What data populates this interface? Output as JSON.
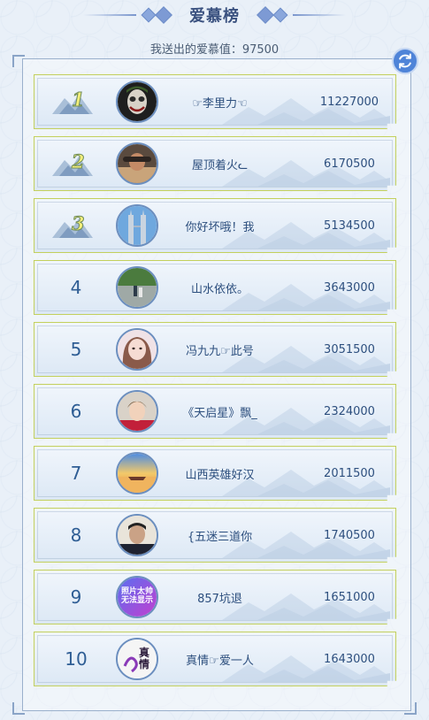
{
  "header": {
    "title": "爱慕榜"
  },
  "sent": {
    "label": "我送出的爱慕值：97500"
  },
  "colors": {
    "accent": "#4f84d8",
    "row_border": "#c3d05c",
    "text": "#2d4f7e"
  },
  "rows": [
    {
      "rank": "1",
      "name": "☞李里力☜",
      "score": "11227000",
      "avatar": "dark-portrait"
    },
    {
      "rank": "2",
      "name": "屋顶着火ᓚ",
      "score": "6170500",
      "avatar": "sunset-portrait"
    },
    {
      "rank": "3",
      "name": "你好坏哦！我",
      "score": "5134500",
      "avatar": "towers"
    },
    {
      "rank": "4",
      "name": "山水依依。",
      "score": "3643000",
      "avatar": "landscape"
    },
    {
      "rank": "5",
      "name": "冯九九☞此号",
      "score": "3051500",
      "avatar": "girl-portrait"
    },
    {
      "rank": "6",
      "name": "《天启星》飘_",
      "score": "2324000",
      "avatar": "boy-portrait"
    },
    {
      "rank": "7",
      "name": "山西英雄好汉",
      "score": "2011500",
      "avatar": "sunset-boat"
    },
    {
      "rank": "8",
      "name": "{五迷三道你",
      "score": "1740500",
      "avatar": "man-portrait"
    },
    {
      "rank": "9",
      "name": "857坑退",
      "score": "1651000",
      "avatar": "placeholder",
      "avatar_text": [
        "照片太帅",
        "无法显示"
      ]
    },
    {
      "rank": "10",
      "name": "真情☞爱一人",
      "score": "1643000",
      "avatar": "calligraphy",
      "avatar_text": [
        "真",
        "情"
      ]
    }
  ]
}
